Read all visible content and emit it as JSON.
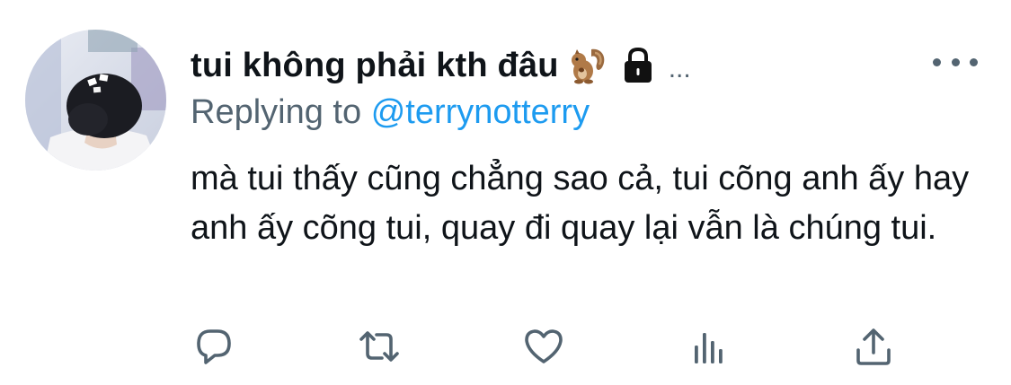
{
  "tweet": {
    "display_name": "tui không phải kth đâu",
    "inline_ellipsis": "...",
    "emoji": "squirrel-emoji",
    "protected_icon": "lock-icon",
    "more_icon": "more-horizontal-icon",
    "reply_prefix": "Replying to",
    "reply_handle": "@terrynotterry",
    "text": "mà tui thấy cũng chẳng sao cả, tui cõng anh ấy hay anh ấy cõng tui, quay đi quay lại vẫn là chúng tui."
  },
  "actions": [
    {
      "name": "reply",
      "icon": "reply-icon"
    },
    {
      "name": "retweet",
      "icon": "retweet-icon"
    },
    {
      "name": "like",
      "icon": "heart-icon"
    },
    {
      "name": "analytics",
      "icon": "analytics-icon"
    },
    {
      "name": "share",
      "icon": "share-icon"
    }
  ],
  "colors": {
    "text": "#0f1419",
    "secondary": "#536471",
    "link": "#1d9bf0",
    "background": "#ffffff"
  }
}
